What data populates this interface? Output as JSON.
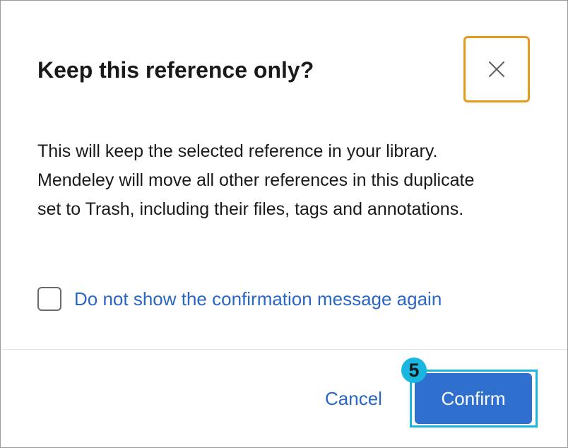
{
  "dialog": {
    "title": "Keep this reference only?",
    "close_icon": "close-icon",
    "message": "This will keep the selected reference in your library. Mendeley will move all other references in this duplicate set to Trash, including their files, tags and annotations.",
    "checkbox": {
      "label": "Do not show the confirmation message again",
      "checked": false
    },
    "footer": {
      "cancel_label": "Cancel",
      "confirm_label": "Confirm"
    },
    "step_badge": "5"
  },
  "colors": {
    "accent_blue": "#2f6fce",
    "link_blue": "#2a67c4",
    "focus_orange": "#e59a1c",
    "highlight_cyan": "#19b6e0"
  }
}
